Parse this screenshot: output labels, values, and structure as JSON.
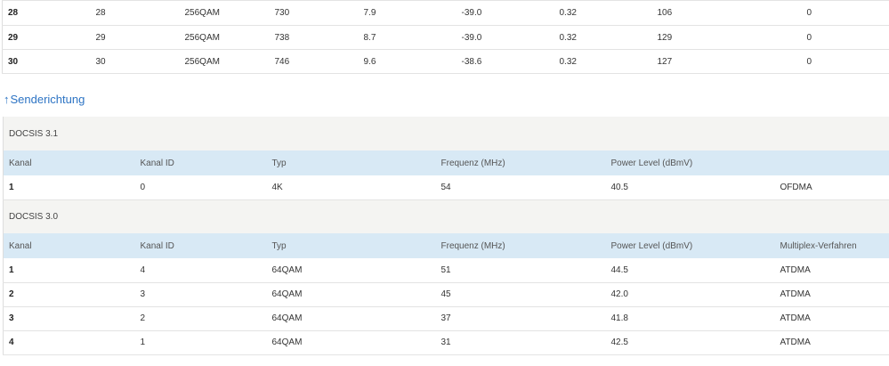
{
  "downstream_rows": [
    {
      "kanal": "28",
      "kanal_id": "28",
      "typ": "256QAM",
      "frequenz": "730",
      "power": "7.9",
      "mse": "-39.0",
      "latenz": "0.32",
      "korr": "106",
      "nichtkorr": "0"
    },
    {
      "kanal": "29",
      "kanal_id": "29",
      "typ": "256QAM",
      "frequenz": "738",
      "power": "8.7",
      "mse": "-39.0",
      "latenz": "0.32",
      "korr": "129",
      "nichtkorr": "0"
    },
    {
      "kanal": "30",
      "kanal_id": "30",
      "typ": "256QAM",
      "frequenz": "746",
      "power": "9.6",
      "mse": "-38.6",
      "latenz": "0.32",
      "korr": "127",
      "nichtkorr": "0"
    }
  ],
  "upstream": {
    "link_label": "Senderichtung",
    "link_arrow": "↑",
    "docsis31": {
      "group_label": "DOCSIS 3.1",
      "headers": {
        "kanal": "Kanal",
        "kanal_id": "Kanal ID",
        "typ": "Typ",
        "frequenz": "Frequenz (MHz)",
        "power": "Power Level (dBmV)",
        "multiplex": ""
      },
      "rows": [
        {
          "kanal": "1",
          "kanal_id": "0",
          "typ": "4K",
          "frequenz": "54",
          "power": "40.5",
          "multiplex": "OFDMA"
        }
      ]
    },
    "docsis30": {
      "group_label": "DOCSIS 3.0",
      "headers": {
        "kanal": "Kanal",
        "kanal_id": "Kanal ID",
        "typ": "Typ",
        "frequenz": "Frequenz (MHz)",
        "power": "Power Level (dBmV)",
        "multiplex": "Multiplex-Verfahren"
      },
      "rows": [
        {
          "kanal": "1",
          "kanal_id": "4",
          "typ": "64QAM",
          "frequenz": "51",
          "power": "44.5",
          "multiplex": "ATDMA"
        },
        {
          "kanal": "2",
          "kanal_id": "3",
          "typ": "64QAM",
          "frequenz": "45",
          "power": "42.0",
          "multiplex": "ATDMA"
        },
        {
          "kanal": "3",
          "kanal_id": "2",
          "typ": "64QAM",
          "frequenz": "37",
          "power": "41.8",
          "multiplex": "ATDMA"
        },
        {
          "kanal": "4",
          "kanal_id": "1",
          "typ": "64QAM",
          "frequenz": "31",
          "power": "42.5",
          "multiplex": "ATDMA"
        }
      ]
    }
  },
  "colors": {
    "link": "#2d74c4",
    "header_bg": "#d8e9f5",
    "group_bg": "#f4f4f2"
  }
}
